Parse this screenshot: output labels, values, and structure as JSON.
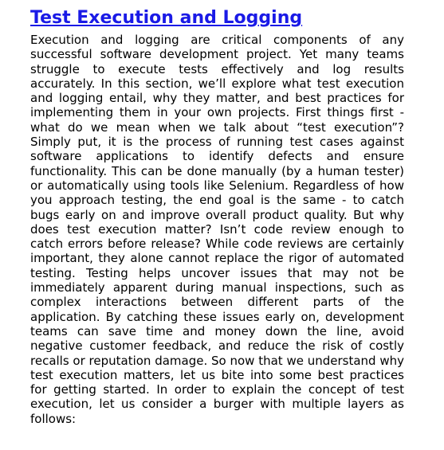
{
  "article": {
    "title": "Test Execution and Logging",
    "body": "Execution and logging are critical components of any successful software development project. Yet many teams struggle to execute tests effectively and log results accurately. In this section, we’ll explore what test execution and logging entail, why they matter, and best practices for implementing them in your own projects. First things first - what do we mean when we talk about “test execution”? Simply put, it is the process of running test cases against software applications to identify defects and ensure functionality. This can be done manually (by a human tester) or automatically using tools like Selenium. Regardless of how you approach testing, the end goal is the same - to catch bugs early on and improve overall product quality. But why does test execution matter? Isn’t code review enough to catch errors before release? While code reviews are certainly important, they alone cannot replace the rigor of automated testing. Testing helps uncover issues that may not be immediately apparent during manual inspections, such as complex interactions between different parts of the application. By catching these issues early on, development teams can save time and money down the line, avoid negative customer feedback, and reduce the risk of costly recalls or reputation damage. So now that we understand why test execution matters, let us bite into some best practices for getting started. In order to explain the concept of test execution, let us consider a burger with multiple layers as follows:"
  },
  "colors": {
    "link": "#1a1ae6",
    "text": "#000000",
    "background": "#ffffff"
  }
}
